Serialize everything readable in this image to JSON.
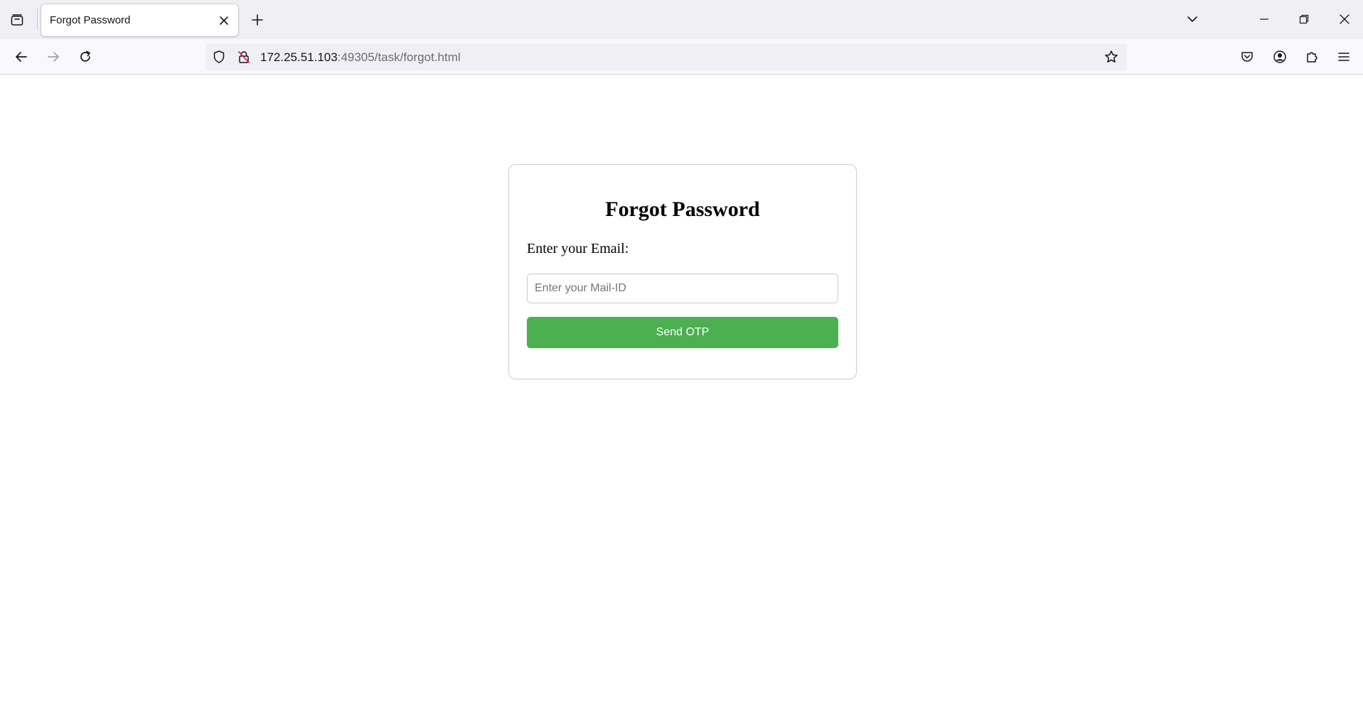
{
  "browser": {
    "tab": {
      "title": "Forgot Password"
    },
    "url": {
      "host": "172.25.51.103",
      "rest": ":49305/task/forgot.html"
    },
    "icons": {
      "tab_list": "tab-list-icon",
      "close_tab": "close-icon",
      "new_tab": "plus-icon",
      "list_all_tabs": "chevron-down-icon",
      "minimize": "minimize-icon",
      "restore": "restore-icon",
      "close_window": "close-icon",
      "back": "arrow-left-icon",
      "forward": "arrow-right-icon",
      "reload": "reload-icon",
      "tracking_protection": "shield-icon",
      "connection": "insecure-lock-icon",
      "bookmark": "star-icon",
      "pocket": "pocket-icon",
      "account": "account-icon",
      "extensions": "puzzle-icon",
      "menu": "hamburger-menu-icon"
    }
  },
  "form": {
    "title": "Forgot Password",
    "email_label": "Enter your Email:",
    "email_value": "",
    "email_placeholder": "Enter your Mail-ID",
    "submit_label": "Send OTP"
  },
  "colors": {
    "primary_button": "#4caf50",
    "tab_strip": "#f0f0f4",
    "toolbar": "#f9f9fb",
    "insecure_indicator": "#e22850"
  }
}
